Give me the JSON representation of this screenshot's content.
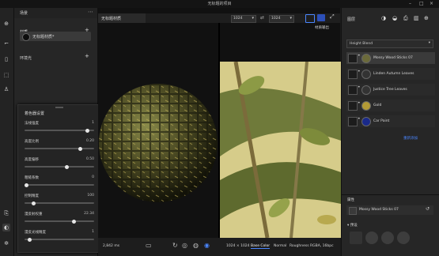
{
  "window": {
    "title": "无标题的项目",
    "min": "–",
    "max": "□",
    "close": "×"
  },
  "left_panel": {
    "title": "场景",
    "material_section": "材质",
    "material_item": "无标题材质*",
    "environment_section": "环境光",
    "add": "+"
  },
  "floating_panel": {
    "title": "着色器设置",
    "sliders": [
      {
        "label": "法线强度",
        "value": "1",
        "fraction": 0.9
      },
      {
        "label": "高度比例",
        "value": "0.20",
        "fraction": 0.8
      },
      {
        "label": "高度偏移",
        "value": "0.50",
        "fraction": 0.6
      },
      {
        "label": "粗糙系数",
        "value": "0",
        "fraction": 0.0
      },
      {
        "label": "控制精度",
        "value": "100",
        "fraction": 0.1
      },
      {
        "label": "漫反射权重",
        "value": "22.34",
        "fraction": 0.7
      },
      {
        "label": "漫反光线精度",
        "value": "1",
        "fraction": 0.05
      }
    ]
  },
  "viewport": {
    "tab_title": "无标题材质",
    "res1": "1024",
    "res2": "1024",
    "right_label": "材质输出",
    "bottom_left": "2,842 ms",
    "bottom_res": "1024 × 1024",
    "channels": [
      "Base Color",
      "Normal",
      "Roughness",
      "RGBA, 16bpc"
    ],
    "active_channel": "Base Color"
  },
  "right_panel": {
    "title": "图层",
    "blend_mode": "Height Blend",
    "layers": [
      {
        "name": "Mossy Wood Sticks 07",
        "selected": true
      },
      {
        "name": "Linden Autumn Leaves",
        "selected": false
      },
      {
        "name": "Justice Tree Leaves",
        "selected": false
      },
      {
        "name": "Gold",
        "selected": false
      },
      {
        "name": "Car Paint",
        "selected": false
      }
    ],
    "link": "重新添加",
    "properties_title": "属性",
    "properties_item": "Mossy Wood Sticks 07",
    "presets_title": "预设"
  },
  "colors": {
    "accent": "#2c4fb8",
    "link": "#4a86ff"
  }
}
